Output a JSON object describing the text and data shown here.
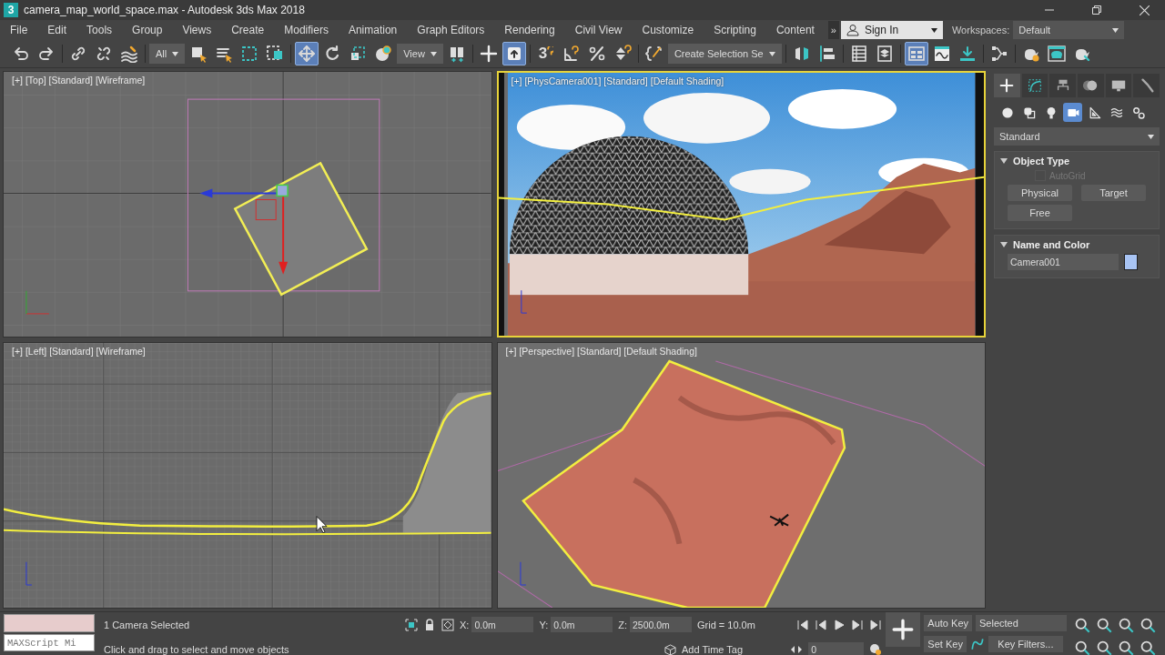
{
  "window": {
    "title": "camera_map_world_space.max - Autodesk 3ds Max 2018"
  },
  "menu": [
    "File",
    "Edit",
    "Tools",
    "Group",
    "Views",
    "Create",
    "Modifiers",
    "Animation",
    "Graph Editors",
    "Rendering",
    "Civil View",
    "Customize",
    "Scripting",
    "Content"
  ],
  "menu_overflow": "»",
  "sign_in": "Sign In",
  "workspaces": {
    "label": "Workspaces:",
    "value": "Default"
  },
  "app_logo": "3",
  "toolbar": [
    [
      {
        "kind": "undo",
        "selected": false
      },
      {
        "kind": "redo",
        "selected": false
      }
    ],
    [
      {
        "kind": "link",
        "selected": false
      },
      {
        "kind": "unlink",
        "selected": false
      },
      {
        "kind": "wave",
        "selected": false
      }
    ],
    [
      {
        "kind": "dropdown",
        "value": "All",
        "selected": false
      },
      {
        "kind": "cursor-square",
        "selected": false
      },
      {
        "kind": "list",
        "selected": false
      },
      {
        "kind": "dashed-square",
        "selected": false
      },
      {
        "kind": "dashed-fill",
        "selected": false
      }
    ],
    [
      {
        "kind": "move",
        "selected": true
      },
      {
        "kind": "rotate",
        "selected": false
      },
      {
        "kind": "scale",
        "selected": false
      },
      {
        "kind": "ball",
        "selected": false
      },
      {
        "kind": "dropdown",
        "value": "View",
        "selected": false
      },
      {
        "kind": "pivot",
        "selected": false
      }
    ],
    [
      {
        "kind": "crosshair",
        "selected": false
      },
      {
        "kind": "up-key",
        "selected": true
      }
    ],
    [
      {
        "kind": "snap3",
        "label": "3",
        "selected": false
      },
      {
        "kind": "angle",
        "selected": false
      },
      {
        "kind": "percent",
        "selected": false
      },
      {
        "kind": "spinner",
        "selected": false
      }
    ],
    [
      {
        "kind": "braces",
        "selected": false
      },
      {
        "kind": "dropdown",
        "value": "Create Selection Se",
        "selected": false
      }
    ],
    [
      {
        "kind": "mirror",
        "selected": false
      },
      {
        "kind": "align",
        "selected": false
      }
    ],
    [
      {
        "kind": "table",
        "selected": false
      },
      {
        "kind": "layers",
        "selected": false
      }
    ],
    [
      {
        "kind": "ribbon",
        "selected": true
      },
      {
        "kind": "curve",
        "selected": false
      },
      {
        "kind": "download",
        "selected": false
      }
    ],
    [
      {
        "kind": "nodes",
        "selected": false
      }
    ],
    [
      {
        "kind": "teapot-gear",
        "selected": false
      },
      {
        "kind": "teapot-frame",
        "selected": false
      },
      {
        "kind": "teapot",
        "selected": false
      }
    ]
  ],
  "viewports": [
    {
      "kind": "top",
      "label": "[+] [Top] [Standard] [Wireframe]",
      "active": false
    },
    {
      "kind": "camera",
      "label": "[+] [PhysCamera001] [Standard] [Default Shading]",
      "active": true
    },
    {
      "kind": "left",
      "label": "[+] [Left] [Standard] [Wireframe]",
      "active": false
    },
    {
      "kind": "perspective",
      "label": "[+] [Perspective] [Standard] [Default Shading]",
      "active": false
    }
  ],
  "command_panel": {
    "tabs": [
      {
        "kind": "plus",
        "selected": true
      },
      {
        "kind": "curve-box",
        "selected": false
      },
      {
        "kind": "hierarchy",
        "selected": false
      },
      {
        "kind": "spheres",
        "selected": false
      },
      {
        "kind": "monitor",
        "selected": false
      },
      {
        "kind": "wrench",
        "selected": false
      }
    ],
    "categories": [
      {
        "kind": "sphere",
        "selected": false
      },
      {
        "kind": "shapes",
        "selected": false
      },
      {
        "kind": "bulb",
        "selected": false
      },
      {
        "kind": "camera",
        "selected": true
      },
      {
        "kind": "triangle",
        "selected": false
      },
      {
        "kind": "waves",
        "selected": false
      },
      {
        "kind": "gears",
        "selected": false
      }
    ],
    "type_dropdown": "Standard",
    "object_type": {
      "title": "Object Type",
      "expanded": true,
      "autogrid": {
        "label": "AutoGrid",
        "checked": false,
        "disabled": true
      },
      "buttons": [
        "Physical",
        "Target",
        "Free"
      ]
    },
    "name_and_color": {
      "title": "Name and Color",
      "expanded": true,
      "name": "Camera001",
      "color": "#a8c4f4"
    }
  },
  "status": {
    "listener": "MAXScript Mi",
    "selection": "1 Camera Selected",
    "prompt": "Click and drag to select and move objects",
    "coords": [
      {
        "label": "X:",
        "value": "0.0m"
      },
      {
        "label": "Y:",
        "value": "0.0m"
      },
      {
        "label": "Z:",
        "value": "2500.0m"
      }
    ],
    "grid": "Grid = 10.0m",
    "time_tag": "Add Time Tag",
    "frame": "0",
    "auto_key": "Auto Key",
    "key_mode": "Selected",
    "set_key": "Set Key",
    "key_filters": "Key Filters..."
  }
}
